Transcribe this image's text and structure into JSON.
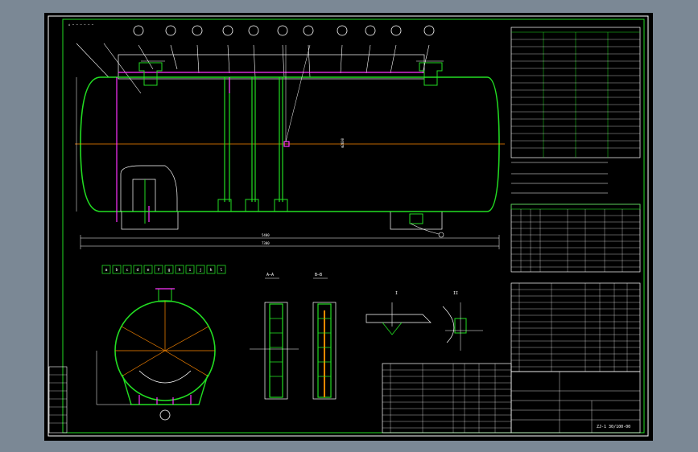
{
  "app": {
    "background_color": "#7b8895",
    "canvas_color": "#000000"
  },
  "colors": {
    "frame": "#ffffff",
    "vessel": "#22dd22",
    "centerline": "#ff8800",
    "nozzle": "#ff33ff",
    "table": "#22dd22",
    "text": "#ffffff"
  },
  "drawing": {
    "nozzle_marks": [
      "a",
      "b",
      "c",
      "d",
      "e",
      "f",
      "g",
      "h",
      "i",
      "j",
      "k",
      "l"
    ],
    "section_labels": {
      "section_aa": "A—A",
      "section_bb": "B—B",
      "detail_1": "I",
      "detail_2": "II"
    },
    "dimension_dim": "2600"
  },
  "title_block": {
    "drawing_no": "ZJ-1 30/100-00"
  }
}
